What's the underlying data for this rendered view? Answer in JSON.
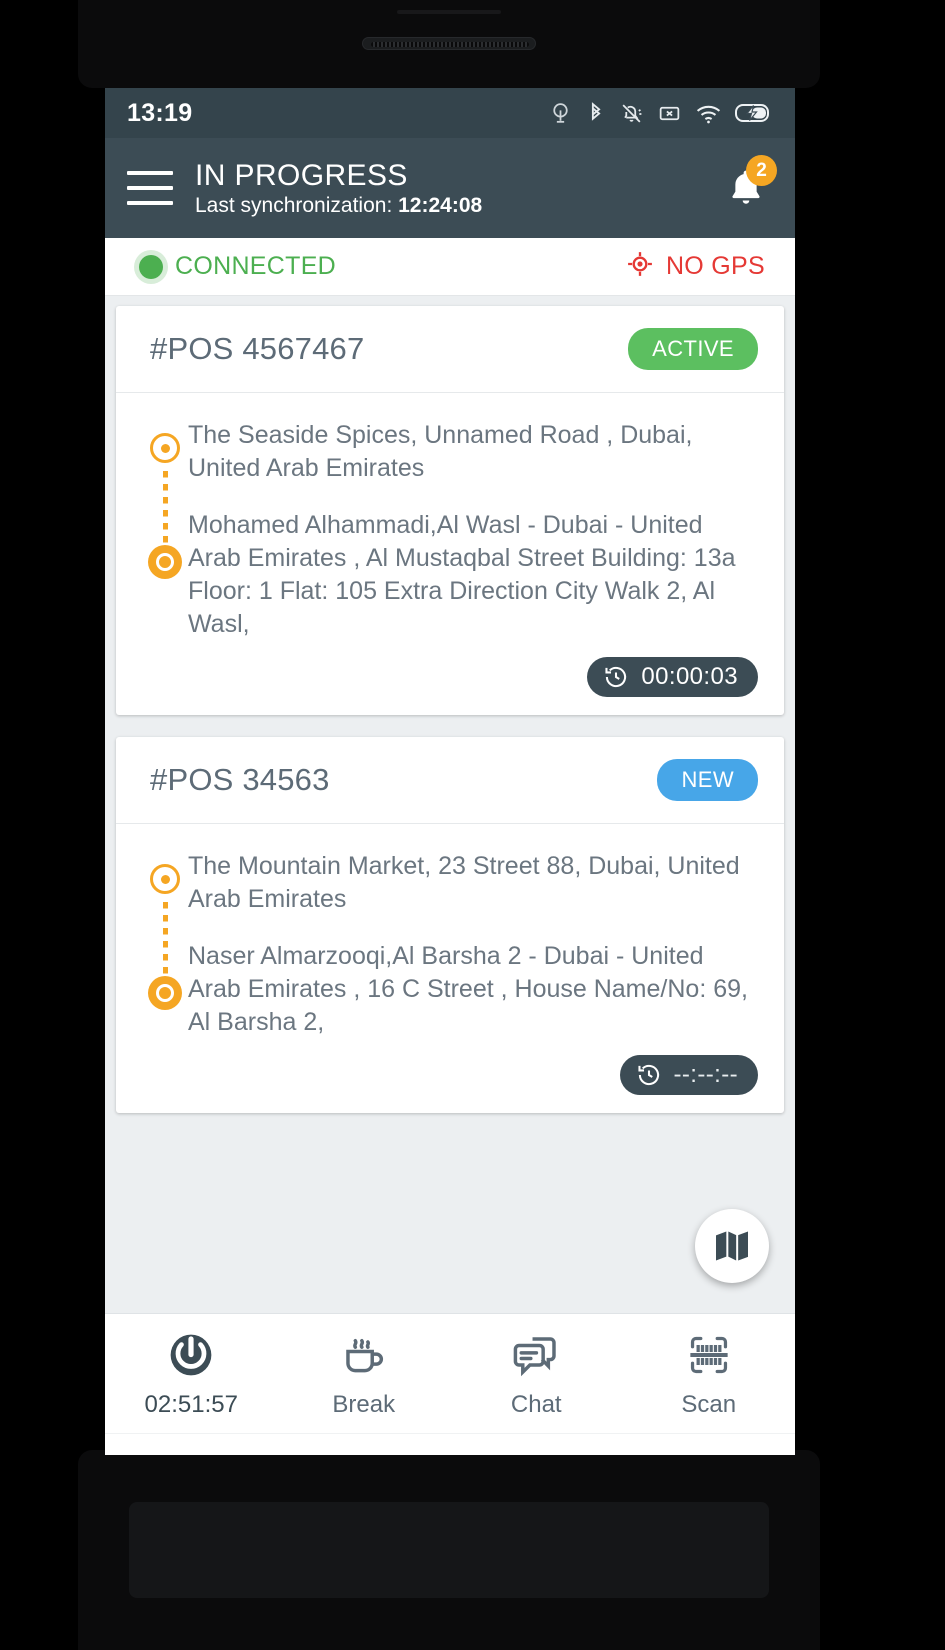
{
  "status_bar": {
    "clock": "13:19",
    "icons": [
      "cast-icon",
      "bluetooth-icon",
      "notifications-off-icon",
      "sim-error-icon",
      "wifi-icon",
      "battery-charging-icon"
    ]
  },
  "app_bar": {
    "menu_icon": "hamburger-menu-icon",
    "title": "IN PROGRESS",
    "sync_label": "Last synchronization:",
    "sync_time": "12:24:08",
    "bell_icon": "notification-bell-icon",
    "bell_badge": "2"
  },
  "connection": {
    "status_text": "CONNECTED",
    "status_color": "#4caf50",
    "gps_text": "NO GPS",
    "gps_color": "#e53935",
    "gps_icon": "gps-crosshair-icon"
  },
  "orders": [
    {
      "pos_id": "#POS 4567467",
      "state_label": "ACTIVE",
      "state_color": "#5cbf60",
      "pickup": "The Seaside Spices, Unnamed Road , Dubai, United Arab Emirates",
      "dropoff": "Mohamed Alhammadi,Al Wasl - Dubai - United Arab Emirates  , Al Mustaqbal Street Building: 13a Floor: 1 Flat: 105 Extra Direction City Walk 2, Al Wasl,",
      "timer": "00:00:03",
      "timer_icon": "history-clock-icon"
    },
    {
      "pos_id": "#POS 34563",
      "state_label": "NEW",
      "state_color": "#47a6e8",
      "pickup": "The Mountain Market, 23 Street 88, Dubai, United Arab Emirates",
      "dropoff": "Naser Almarzooqi,Al Barsha 2 - Dubai - United Arab Emirates , 16 C Street , House Name/No: 69, Al Barsha 2,",
      "timer": "--:--:--",
      "timer_icon": "history-clock-icon"
    }
  ],
  "map_fab": {
    "icon": "map-icon"
  },
  "tab_bar": {
    "tabs": [
      {
        "icon": "power-button-icon",
        "label": "02:51:57"
      },
      {
        "icon": "coffee-cup-icon",
        "label": "Break"
      },
      {
        "icon": "chat-bubbles-icon",
        "label": "Chat"
      },
      {
        "icon": "barcode-scan-icon",
        "label": "Scan"
      }
    ]
  },
  "nav_bar": {
    "buttons": [
      "recent-apps-icon",
      "home-icon",
      "back-icon"
    ]
  }
}
